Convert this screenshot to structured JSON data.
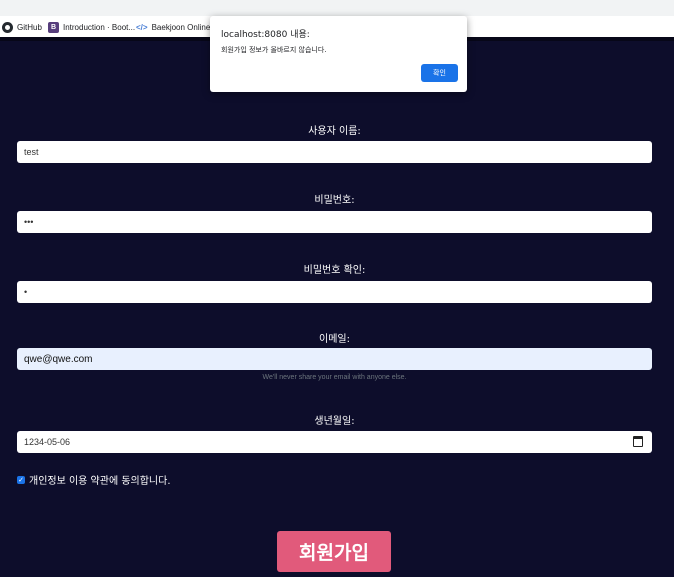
{
  "bookmarks": [
    {
      "label": "GitHub",
      "icon": "github-icon"
    },
    {
      "label": "Introduction · Boot...",
      "icon": "bootstrap-icon",
      "icon_text": "B"
    },
    {
      "label": "Baekjoon Online J...",
      "icon": "code-icon",
      "icon_text": "</>"
    }
  ],
  "dialog": {
    "title": "localhost:8080 내용:",
    "message": "회원가입 정보가 올바르지 않습니다.",
    "ok_label": "확인"
  },
  "form": {
    "username": {
      "label": "사용자 이름:",
      "value": "test"
    },
    "password": {
      "label": "비밀번호:",
      "value": "•••"
    },
    "password_confirm": {
      "label": "비밀번호 확인:",
      "value": "•"
    },
    "email": {
      "label": "이메일:",
      "value": "qwe@qwe.com",
      "help": "We'll never share your email with anyone else."
    },
    "birthdate": {
      "label": "생년월일:",
      "value": "1234-05-06",
      "icon": "calendar-icon"
    },
    "agree": {
      "label": "개인정보 이용 약관에 동의합니다.",
      "checked": true,
      "check_glyph": "✓"
    },
    "submit_label": "회원가입"
  },
  "colors": {
    "page_background": "#0d0d2b",
    "submit_button": "#e15a7b",
    "dialog_button": "#1a73e8",
    "email_autofill": "#e8f0fe"
  }
}
